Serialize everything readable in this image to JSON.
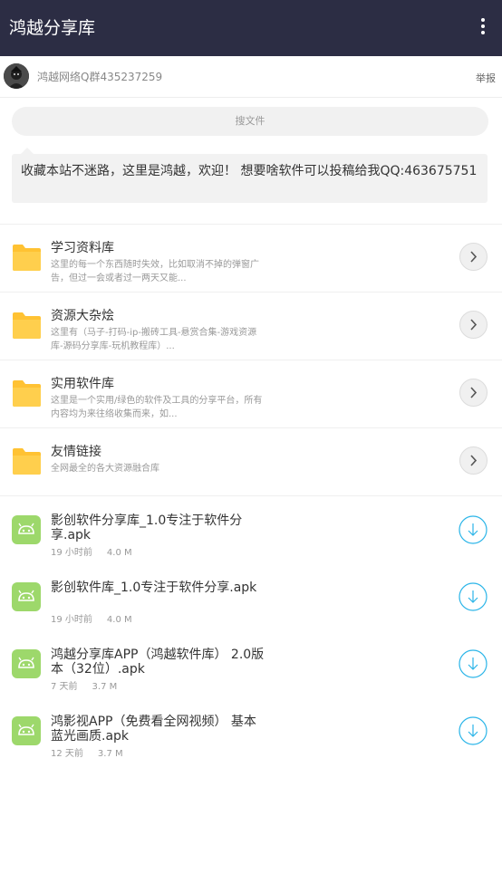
{
  "appbar": {
    "title": "鸿越分享库",
    "menu_icon": "more-vertical-icon"
  },
  "owner": {
    "name": "鸿越网络Q群435237259",
    "report": "举报"
  },
  "search": {
    "placeholder": "搜文件"
  },
  "notice": {
    "text": "收藏本站不迷路，这里是鸿越，欢迎！ 想要啥软件可以投稿给我QQ:463675751"
  },
  "folders": [
    {
      "name": "学习资料库",
      "desc": "这里的每一个东西随时失效，比如取消不掉的弹窗广告，但过一会或者过一两天又能..."
    },
    {
      "name": "资源大杂烩",
      "desc": "这里有（马子-打码-ip-搬砖工具-悬赏合集-游戏资源库-源码分享库-玩机教程库）..."
    },
    {
      "name": "实用软件库",
      "desc": "这里是一个实用/绿色的软件及工具的分享平台，所有内容均为来往络收集而来，如..."
    },
    {
      "name": "友情链接",
      "desc": "全网最全的各大资源融合库"
    }
  ],
  "files": [
    {
      "name": "影创软件分享库_1.0专注于软件分享.apk",
      "time": "19 小时前",
      "size": "4.0 M"
    },
    {
      "name": "影创软件库_1.0专注于软件分享.apk",
      "time": "19 小时前",
      "size": "4.0 M"
    },
    {
      "name": "鸿越分享库APP（鸿越软件库） 2.0版本（32位）.apk",
      "time": "7 天前",
      "size": "3.7 M"
    },
    {
      "name": "鸿影视APP（免费看全网视频） 基本蓝光画质.apk",
      "time": "12 天前",
      "size": "3.7 M"
    }
  ],
  "colors": {
    "appbar": "#2c2d44",
    "folder": "#ffc233",
    "android": "#9dd86b",
    "download": "#2bb5e8"
  }
}
